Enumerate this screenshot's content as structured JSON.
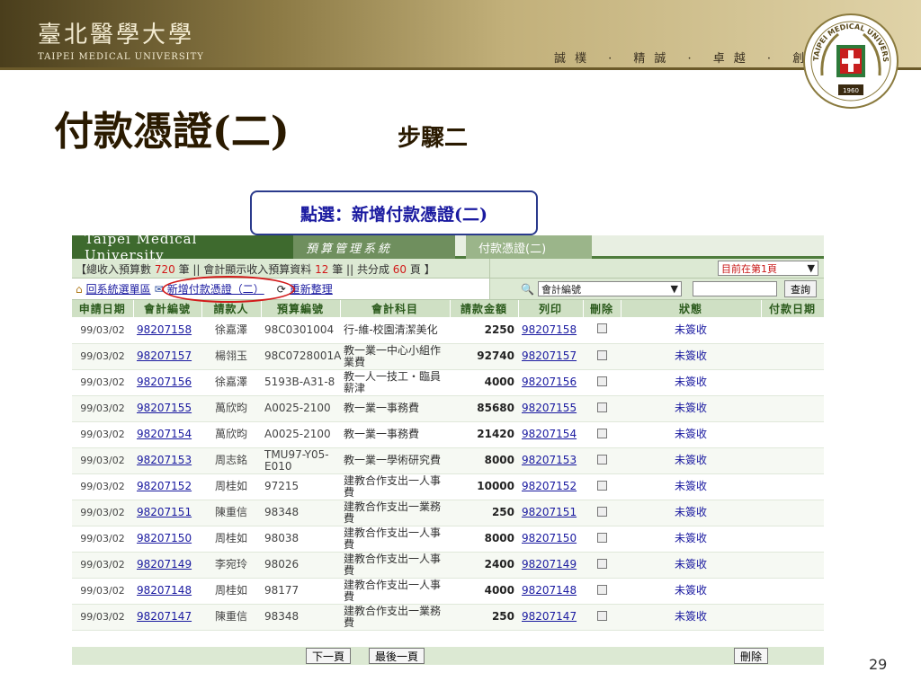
{
  "banner": {
    "university_cn": "臺北醫學大學",
    "university_en": "TAIPEI MEDICAL UNIVERSITY",
    "motto": "誠樸 · 精誠 · 卓越 · 創新",
    "logo": {
      "ring_text": "TAIPEI MEDICAL UNIVERSITY",
      "year": "1960",
      "icon": "university-seal-icon"
    }
  },
  "slide": {
    "title": "付款憑證(二)",
    "subtitle": "步驟二",
    "callout": "點選：新增付款憑證(二)",
    "page_number": "29"
  },
  "app": {
    "tabs": {
      "university": "Taipei Medical University",
      "system": "預算管理系統",
      "current": "付款憑證(二)"
    },
    "info": {
      "prefix": "【總收入預算數",
      "total_count": "720",
      "mid1": "筆 || 會計顯示收入預算資料",
      "shown_count": "12",
      "mid2": "筆 || 共分成",
      "pages": "60",
      "suffix": "頁 】",
      "page_select": "目前在第1頁"
    },
    "toolbar": {
      "back_link": "回系統選單區",
      "add_link": "新增付款憑證（二）",
      "refresh_link": "重新整理",
      "field_select": "會計編號",
      "query_button": "查詢"
    },
    "columns": [
      "申請日期",
      "會計編號",
      "請款人",
      "預算編號",
      "會計科目",
      "請款金額",
      "列印",
      "刪除",
      "狀態",
      "付款日期"
    ],
    "rows": [
      {
        "date": "99/03/02",
        "acct_no": "98207158",
        "requester": "徐嘉澤",
        "budget_no": "98C0301004",
        "subject": "行-維-校園清潔美化",
        "amount": "2250",
        "print": "98207158",
        "status": "未簽收",
        "pay_date": ""
      },
      {
        "date": "99/03/02",
        "acct_no": "98207157",
        "requester": "楊翎玉",
        "budget_no": "98C0728001A",
        "subject": "教一業一中心小組作業費",
        "amount": "92740",
        "print": "98207157",
        "status": "未簽收",
        "pay_date": ""
      },
      {
        "date": "99/03/02",
        "acct_no": "98207156",
        "requester": "徐嘉澤",
        "budget_no": "5193B-A31-8",
        "subject": "教一人一技工・臨員薪津",
        "amount": "4000",
        "print": "98207156",
        "status": "未簽收",
        "pay_date": ""
      },
      {
        "date": "99/03/02",
        "acct_no": "98207155",
        "requester": "萬欣昀",
        "budget_no": "A0025-2100",
        "subject": "教一業一事務費",
        "amount": "85680",
        "print": "98207155",
        "status": "未簽收",
        "pay_date": ""
      },
      {
        "date": "99/03/02",
        "acct_no": "98207154",
        "requester": "萬欣昀",
        "budget_no": "A0025-2100",
        "subject": "教一業一事務費",
        "amount": "21420",
        "print": "98207154",
        "status": "未簽收",
        "pay_date": ""
      },
      {
        "date": "99/03/02",
        "acct_no": "98207153",
        "requester": "周志銘",
        "budget_no": "TMU97-Y05-E010",
        "subject": "教一業一學術研究費",
        "amount": "8000",
        "print": "98207153",
        "status": "未簽收",
        "pay_date": ""
      },
      {
        "date": "99/03/02",
        "acct_no": "98207152",
        "requester": "周桂如",
        "budget_no": "97215",
        "subject": "建教合作支出一人事費",
        "amount": "10000",
        "print": "98207152",
        "status": "未簽收",
        "pay_date": ""
      },
      {
        "date": "99/03/02",
        "acct_no": "98207151",
        "requester": "陳重信",
        "budget_no": "98348",
        "subject": "建教合作支出一業務費",
        "amount": "250",
        "print": "98207151",
        "status": "未簽收",
        "pay_date": ""
      },
      {
        "date": "99/03/02",
        "acct_no": "98207150",
        "requester": "周桂如",
        "budget_no": "98038",
        "subject": "建教合作支出一人事費",
        "amount": "8000",
        "print": "98207150",
        "status": "未簽收",
        "pay_date": ""
      },
      {
        "date": "99/03/02",
        "acct_no": "98207149",
        "requester": "李宛玲",
        "budget_no": "98026",
        "subject": "建教合作支出一人事費",
        "amount": "2400",
        "print": "98207149",
        "status": "未簽收",
        "pay_date": ""
      },
      {
        "date": "99/03/02",
        "acct_no": "98207148",
        "requester": "周桂如",
        "budget_no": "98177",
        "subject": "建教合作支出一人事費",
        "amount": "4000",
        "print": "98207148",
        "status": "未簽收",
        "pay_date": ""
      },
      {
        "date": "99/03/02",
        "acct_no": "98207147",
        "requester": "陳重信",
        "budget_no": "98348",
        "subject": "建教合作支出一業務費",
        "amount": "250",
        "print": "98207147",
        "status": "未簽收",
        "pay_date": ""
      }
    ],
    "footer": {
      "next_page": "下一頁",
      "last_page": "最後一頁",
      "delete": "刪除"
    }
  },
  "icons": {
    "home": "home-icon",
    "add": "new-document-icon",
    "refresh": "refresh-icon",
    "search": "search-icon",
    "dropdown": "chevron-down-icon"
  },
  "colors": {
    "banner_gold": "#c2b07a",
    "app_green": "#3e6a2e",
    "header_green": "#cfe0c4",
    "highlight_red": "#d21a1a",
    "link_blue": "#1a1aa0"
  }
}
